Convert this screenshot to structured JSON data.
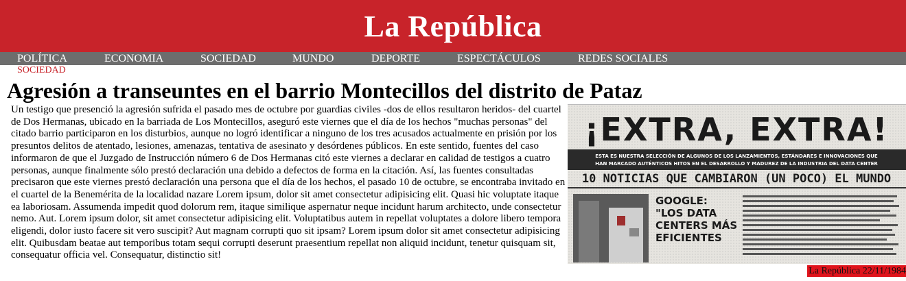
{
  "masthead": {
    "title": "La República"
  },
  "nav": {
    "items": [
      {
        "label": "POLÍTICA"
      },
      {
        "label": "ECONOMIA"
      },
      {
        "label": "SOCIEDAD"
      },
      {
        "label": "MUNDO"
      },
      {
        "label": "DEPORTE"
      },
      {
        "label": "ESPECTÁCULOS"
      },
      {
        "label": "REDES SOCIALES"
      }
    ]
  },
  "article": {
    "category": "SOCIEDAD",
    "headline": "Agresión a transeuntes en el barrio Montecillos del distrito de Pataz",
    "body": "Un testigo que presenció la agresión sufrida el pasado mes de octubre por guardias civiles -dos de ellos resultaron heridos- del cuartel de Dos Hermanas, ubicado en la barriada de Los Montecillos, aseguró este viernes que el día de los hechos \"muchas personas\" del citado barrio participaron en los disturbios, aunque no logró identificar a ninguno de los tres acusados actualmente en prisión por los presuntos delitos de atentado, lesiones, amenazas, tentativa de asesinato y desórdenes públicos. En este sentido, fuentes del caso informaron de que el Juzgado de Instrucción número 6 de Dos Hermanas citó este viernes a declarar en calidad de testigos a cuatro personas, aunque finalmente sólo prestó declaración una debido a defectos de forma en la citación. Así, las fuentes consultadas precisaron que este viernes prestó declaración una persona que el día de los hechos, el pasado 10 de octubre, se encontraba invitado en el cuartel de la Benemérita de la localidad nazare Lorem ipsum, dolor sit amet consectetur adipisicing elit. Quasi hic voluptate itaque ea laboriosam. Assumenda impedit quod dolorum rem, itaque similique aspernatur neque incidunt harum architecto, unde consectetur nemo. Aut. Lorem ipsum dolor, sit amet consectetur adipisicing elit. Voluptatibus autem in repellat voluptates a dolore libero tempora eligendi, dolor iusto facere sit vero suscipit? Aut magnam corrupti quo sit ipsam? Lorem ipsum dolor sit amet consectetur adipisicing elit. Quibusdam beatae aut temporibus totam sequi corrupti deserunt praesentium repellat non aliquid incidunt, tenetur quisquam sit, consequatur officia vel. Consequatur, distinctio sit!"
  },
  "image": {
    "banner": "¡EXTRA, EXTRA!",
    "deck_line1": "ESTA ES NUESTRA SELECCIÓN DE ALGUNOS DE LOS LANZAMIENTOS, ESTÁNDARES E INNOVACIONES QUE",
    "deck_line2": "HAN MARCADO AUTÉNTICOS HITOS EN EL DESARROLLO Y MADUREZ DE LA INDUSTRIA DEL DATA CENTER",
    "subhead": "10 NOTICIAS QUE CAMBIARON (UN POCO) EL MUNDO",
    "story_title_1": "GOOGLE:",
    "story_title_2": "\"LOS DATA",
    "story_title_3": "CENTERS MÁS",
    "story_title_4": "EFICIENTES"
  },
  "footer": {
    "date": "La República 22/11/1984"
  },
  "colors": {
    "brand_red": "#c8232a",
    "nav_gray": "#6d6d6d",
    "footer_red": "#e0141c"
  }
}
